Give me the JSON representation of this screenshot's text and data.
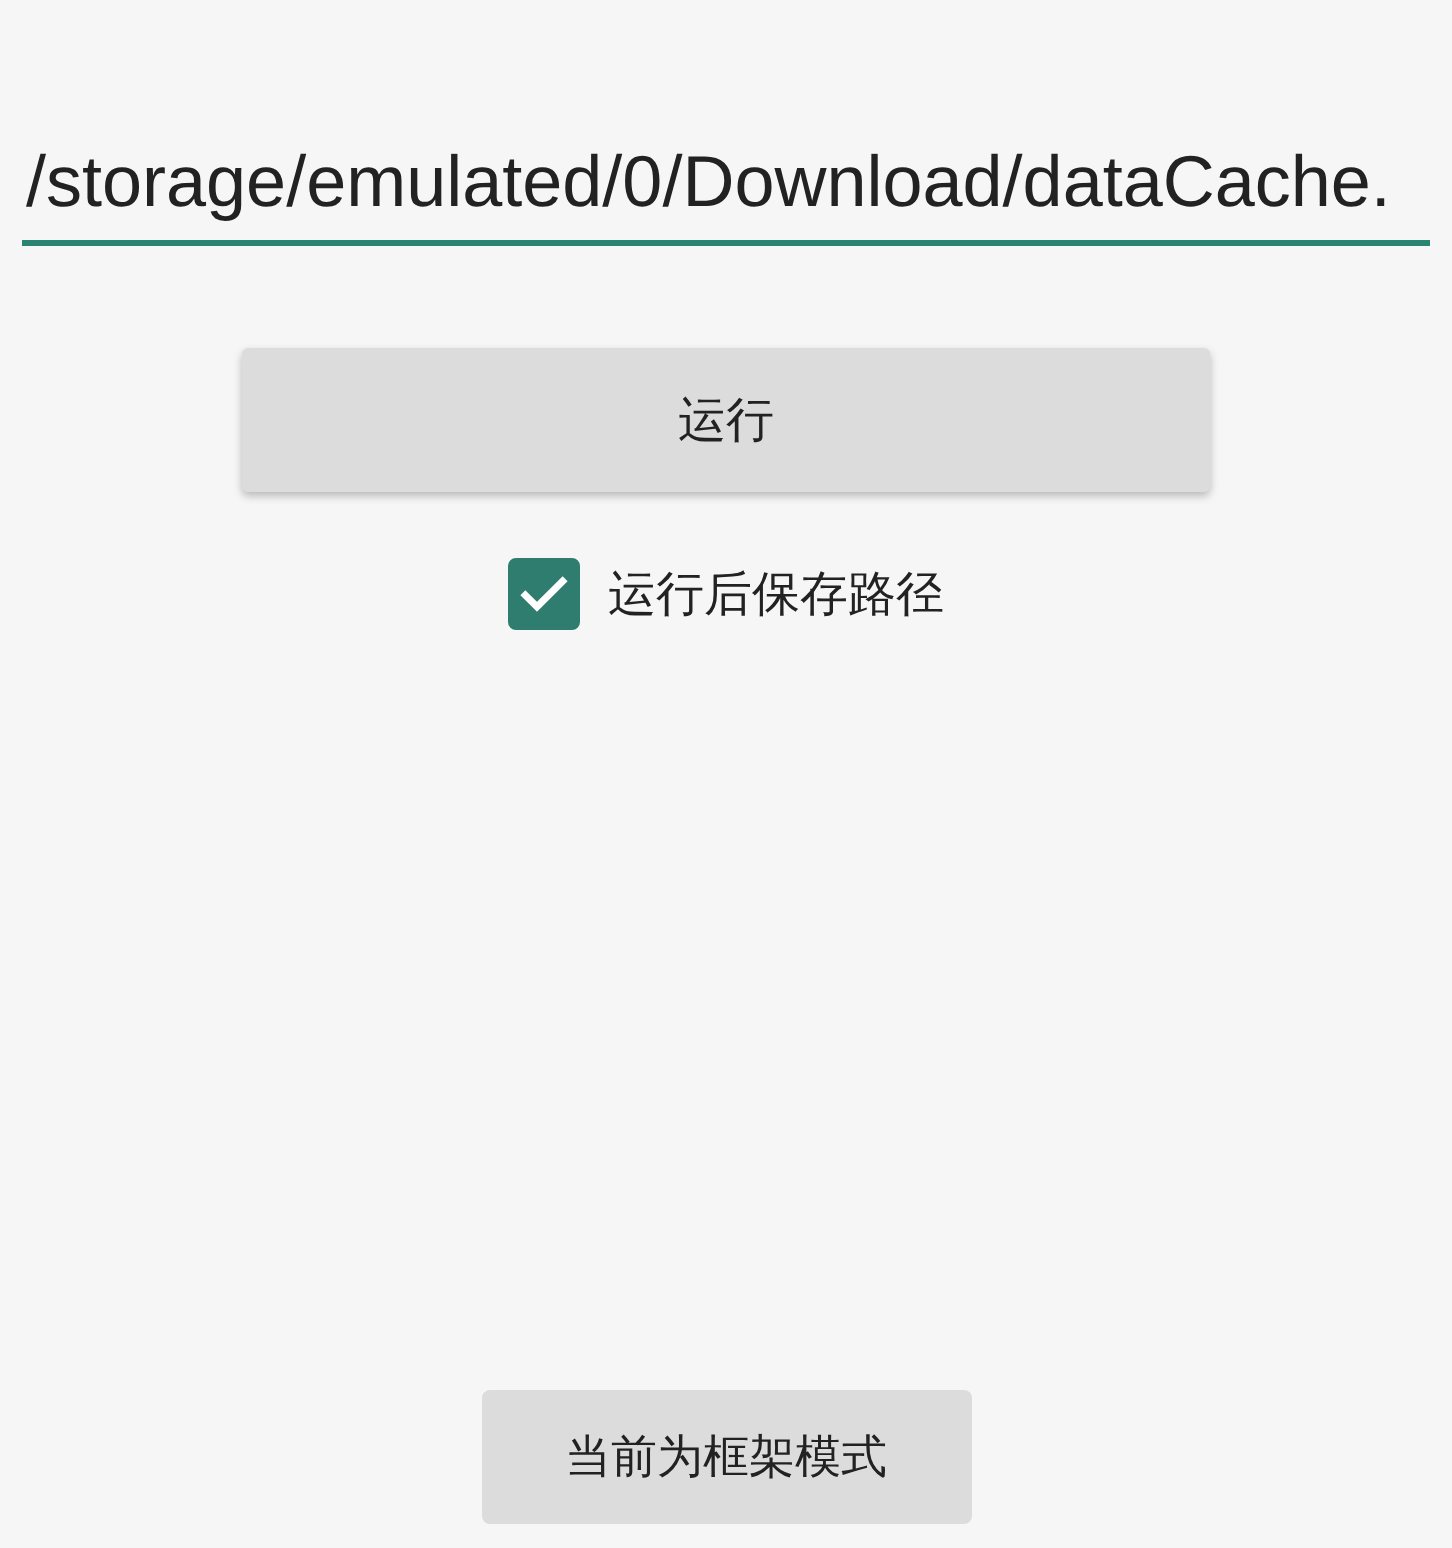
{
  "path_field": {
    "value": "/storage/emulated/0/Download/dataCache."
  },
  "run_button": {
    "label": "运行"
  },
  "save_path_checkbox": {
    "label": "运行后保存路径",
    "checked": true
  },
  "mode_button": {
    "label": "当前为框架模式"
  }
}
